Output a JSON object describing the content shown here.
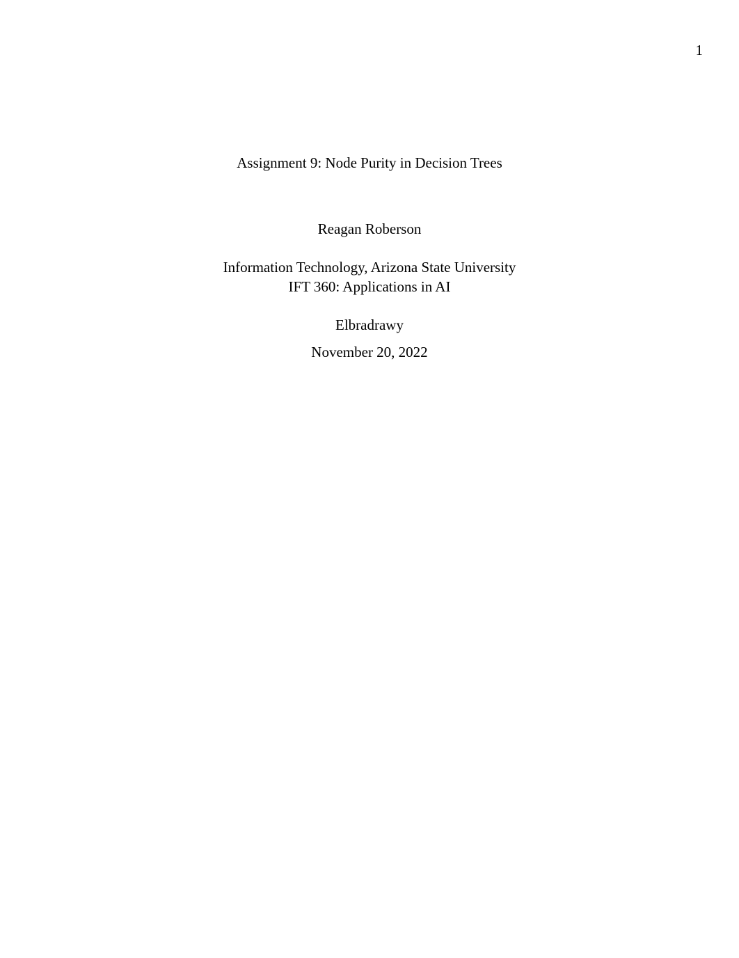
{
  "page": {
    "number": "1"
  },
  "document": {
    "title": "Assignment 9: Node Purity in Decision Trees",
    "author": "Reagan Roberson",
    "affiliation": "Information Technology, Arizona State University",
    "course": "IFT 360: Applications in AI",
    "instructor": "Elbradrawy",
    "date": "November 20, 2022"
  }
}
